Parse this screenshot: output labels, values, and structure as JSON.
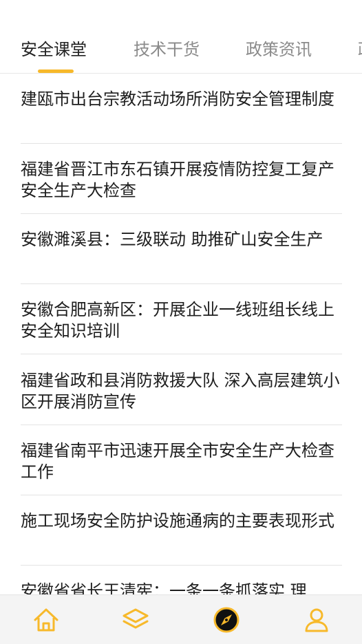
{
  "tabs": [
    {
      "label": "安全课堂",
      "active": true
    },
    {
      "label": "技术干货",
      "active": false
    },
    {
      "label": "政策资讯",
      "active": false
    },
    {
      "label": "政",
      "active": false
    }
  ],
  "articles": [
    {
      "title": "建瓯市出台宗教活动场所消防安全管理制度"
    },
    {
      "title": "福建省晋江市东石镇开展疫情防控复工复产安全生产大检查"
    },
    {
      "title": "安徽濉溪县：三级联动 助推矿山安全生产"
    },
    {
      "title": "安徽合肥高新区：开展企业一线班组长线上安全知识培训"
    },
    {
      "title": "福建省政和县消防救援大队 深入高层建筑小区开展消防宣传"
    },
    {
      "title": "福建省南平市迅速开展全市安全生产大检查工作"
    },
    {
      "title": "施工现场安全防护设施通病的主要表现形式"
    },
    {
      "title": "安徽省省长王清宪：一条一条抓落实 理"
    }
  ],
  "bottom_nav": [
    {
      "icon": "home-icon",
      "active": false
    },
    {
      "icon": "layers-icon",
      "active": false
    },
    {
      "icon": "compass-icon",
      "active": true
    },
    {
      "icon": "user-icon",
      "active": false
    }
  ],
  "colors": {
    "accent": "#f7b92b",
    "text_primary": "#1e1e1e",
    "text_secondary": "#8a8a8a",
    "divider": "#e3e3e3",
    "nav_background": "#f4f4f4"
  }
}
